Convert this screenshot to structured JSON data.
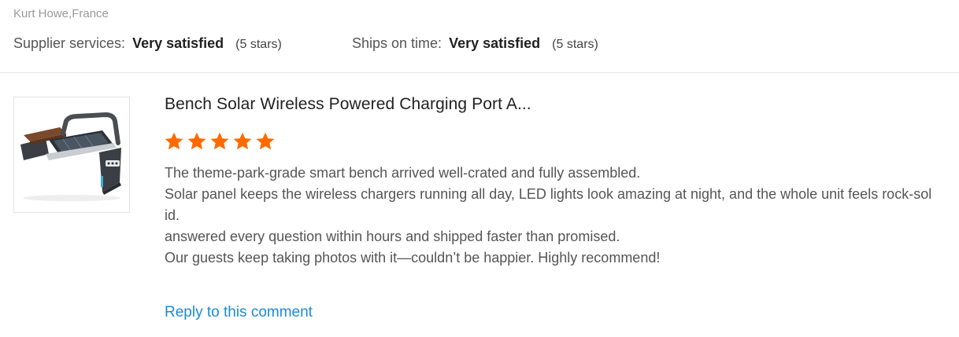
{
  "reviewer": {
    "name_location": "Kurt Howe,France"
  },
  "ratings": {
    "supplier": {
      "label": "Supplier services:",
      "value": "Very satisfied",
      "note": "(5 stars)"
    },
    "shipping": {
      "label": "Ships on time:",
      "value": "Very satisfied",
      "note": "(5 stars)"
    }
  },
  "product": {
    "thumbnail_icon": "solar-bench-image",
    "title": "Bench Solar Wireless Powered Charging Port A...",
    "rating": 5,
    "rating_max": 5,
    "star_color": "#ff6a00"
  },
  "review": {
    "lines": [
      "The theme-park-grade smart bench arrived well-crated and fully assembled.",
      "Solar panel keeps the wireless chargers running all day, LED lights look amazing at night, and the whole unit feels rock-solid.",
      "answered every question within hours and shipped faster than promised.",
      "Our guests keep taking photos with it—couldn’t be happier. Highly recommend!"
    ]
  },
  "actions": {
    "reply_label": "Reply to this comment",
    "link_color": "#1a8cd8"
  }
}
